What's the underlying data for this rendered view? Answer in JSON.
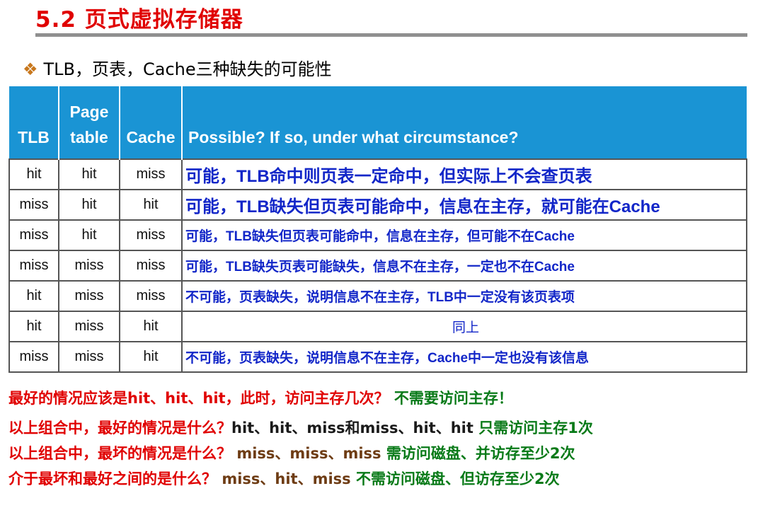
{
  "header": {
    "title": "5.2 页式虚拟存储器",
    "subtitle_bullet": "❖",
    "subtitle": "TLB，页表，Cache三种缺失的可能性"
  },
  "table": {
    "headers": [
      "TLB",
      "Page table",
      "Cache",
      "Possible? If so, under what circumstance?"
    ],
    "rows": [
      {
        "tlb": "hit",
        "page": "hit",
        "cache": "miss",
        "desc": "可能，TLB命中则页表一定命中，但实际上不会查页表"
      },
      {
        "tlb": "miss",
        "page": "hit",
        "cache": "hit",
        "desc": "可能，TLB缺失但页表可能命中，信息在主存，就可能在Cache"
      },
      {
        "tlb": "miss",
        "page": "hit",
        "cache": "miss",
        "desc": "可能，TLB缺失但页表可能命中，信息在主存，但可能不在Cache"
      },
      {
        "tlb": "miss",
        "page": "miss",
        "cache": "miss",
        "desc": "可能，TLB缺失页表可能缺失，信息不在主存，一定也不在Cache"
      },
      {
        "tlb": "hit",
        "page": "miss",
        "cache": "miss",
        "desc": "不可能，页表缺失，说明信息不在主存，TLB中一定没有该页表项"
      },
      {
        "tlb": "hit",
        "page": "miss",
        "cache": "hit",
        "desc": "同上"
      },
      {
        "tlb": "miss",
        "page": "miss",
        "cache": "hit",
        "desc": "不可能，页表缺失，说明信息不在主存，Cache中一定也没有该信息"
      }
    ]
  },
  "notes": [
    {
      "question": "最好的情况应该是hit、hit、hit，此时，访问主存几次？",
      "middle": "",
      "answer": "不需要访问主存！"
    },
    {
      "question": "以上组合中，最好的情况是什么？",
      "middle": "hit、hit、miss和miss、hit、hit",
      "answer": "只需访问主存1次"
    },
    {
      "question": "以上组合中，最坏的情况是什么？",
      "middle": "miss、miss、miss",
      "answer": "需访问磁盘、并访存至少2次"
    },
    {
      "question": "介于最坏和最好之间的是什么？",
      "middle": "miss、hit、miss",
      "answer": "不需访问磁盘、但访存至少2次"
    }
  ],
  "colors": {
    "title": "#e00000",
    "header_bg": "#1a94d4",
    "desc_text": "#1226c8",
    "answer": "#087a18"
  }
}
